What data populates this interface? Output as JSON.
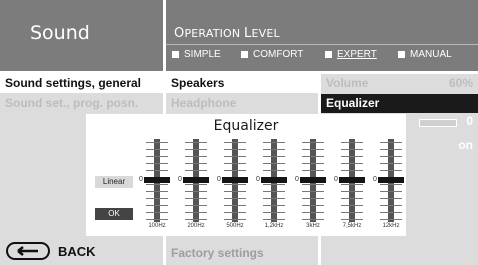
{
  "header": {
    "title": "Sound",
    "subtitle_first": "O",
    "subtitle_rest": "PERATION",
    "subtitle_space": " ",
    "subtitle_first2": "L",
    "subtitle_rest2": "EVEL",
    "modes": [
      {
        "label": "SIMPLE",
        "selected": false
      },
      {
        "label": "COMFORT",
        "selected": false
      },
      {
        "label": "EXPERT",
        "selected": true
      },
      {
        "label": "MANUAL",
        "selected": false
      }
    ]
  },
  "menu": {
    "col1": [
      "Sound settings, general",
      "Sound set., prog. posn."
    ],
    "col2": [
      "Speakers",
      "Headphone",
      "Factory settings"
    ],
    "col3": {
      "volume_label": "Volume",
      "volume_value": "60%",
      "equalizer_label": "Equalizer",
      "mini_value": "0",
      "mini_on": "on"
    }
  },
  "back_label": "BACK",
  "equalizer": {
    "title": "Equalizer",
    "linear_label": "Linear",
    "ok_label": "OK",
    "bands": [
      {
        "freq": "100Hz",
        "value": 0
      },
      {
        "freq": "200Hz",
        "value": 0
      },
      {
        "freq": "500Hz",
        "value": 0
      },
      {
        "freq": "1,2kHz",
        "value": 0
      },
      {
        "freq": "3kHz",
        "value": 0
      },
      {
        "freq": "7,5kHz",
        "value": 0
      },
      {
        "freq": "12kHz",
        "value": 0
      }
    ]
  }
}
